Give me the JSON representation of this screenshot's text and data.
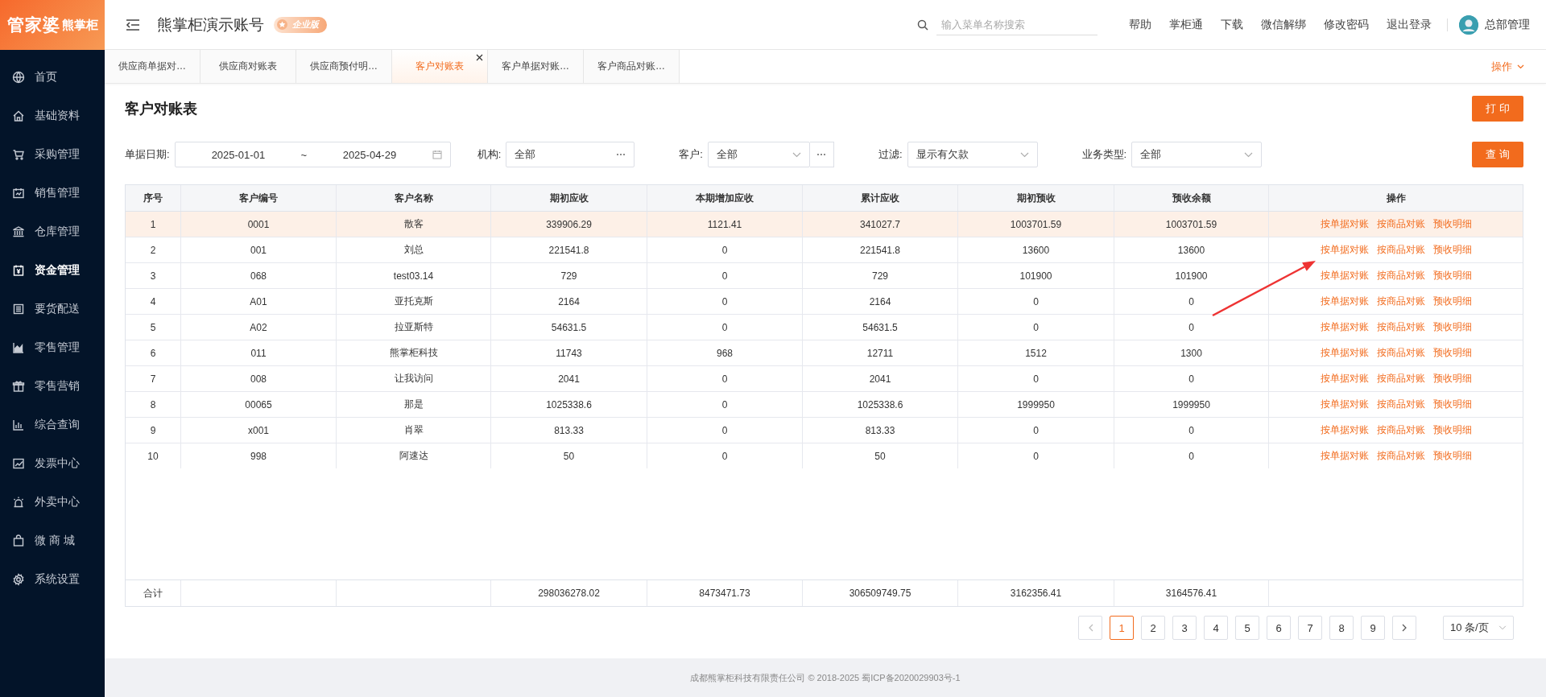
{
  "logo": {
    "main": "管家婆",
    "sub": "熊掌柜"
  },
  "header": {
    "account": "熊掌柜演示账号",
    "badge": "企业版",
    "search": {
      "placeholder": "输入菜单名称搜索"
    },
    "links": [
      "帮助",
      "掌柜通",
      "下载",
      "微信解绑",
      "修改密码",
      "退出登录"
    ],
    "user": "总部管理"
  },
  "sidebar": {
    "items": [
      {
        "label": "首页",
        "selected": false
      },
      {
        "label": "基础资料",
        "selected": false
      },
      {
        "label": "采购管理",
        "selected": false
      },
      {
        "label": "销售管理",
        "selected": false
      },
      {
        "label": "仓库管理",
        "selected": false
      },
      {
        "label": "资金管理",
        "selected": true
      },
      {
        "label": "要货配送",
        "selected": false
      },
      {
        "label": "零售管理",
        "selected": false
      },
      {
        "label": "零售营销",
        "selected": false
      },
      {
        "label": "综合查询",
        "selected": false
      },
      {
        "label": "发票中心",
        "selected": false
      },
      {
        "label": "外卖中心",
        "selected": false
      },
      {
        "label": "微 商 城",
        "selected": false
      },
      {
        "label": "系统设置",
        "selected": false
      }
    ]
  },
  "tabs": {
    "items": [
      {
        "label": "供应商单据对…",
        "selected": false
      },
      {
        "label": "供应商对账表",
        "selected": false
      },
      {
        "label": "供应商预付明…",
        "selected": false
      },
      {
        "label": "客户对账表",
        "selected": true
      },
      {
        "label": "客户单据对账…",
        "selected": false
      },
      {
        "label": "客户商品对账…",
        "selected": false
      }
    ],
    "menu": "操作"
  },
  "page": {
    "title": "客户对账表",
    "print_button": "打 印",
    "query_button": "查 询"
  },
  "filters": [
    {
      "kind": "daterange",
      "label": "单据日期:",
      "start": "2025-01-01",
      "separator": "~",
      "end": "2025-04-29"
    },
    {
      "kind": "picker",
      "label": "机构:",
      "value": "全部"
    },
    {
      "kind": "select_picker",
      "label": "客户:",
      "value": "全部"
    },
    {
      "kind": "select",
      "label": "过滤:",
      "value": "显示有欠款"
    },
    {
      "kind": "select",
      "label": "业务类型:",
      "value": "全部"
    }
  ],
  "table": {
    "columns": [
      "序号",
      "客户编号",
      "客户名称",
      "期初应收",
      "本期增加应收",
      "累计应收",
      "期初预收",
      "预收余额",
      "操作"
    ],
    "rows": [
      {
        "cells": [
          "1",
          "0001",
          "散客",
          "339906.29",
          "1121.41",
          "341027.7",
          "1003701.59",
          "1003701.59"
        ],
        "actions": [
          "按单据对账",
          "按商品对账",
          "预收明细"
        ],
        "selected": true
      },
      {
        "cells": [
          "2",
          "001",
          "刘总",
          "221541.8",
          "0",
          "221541.8",
          "13600",
          "13600"
        ],
        "actions": [
          "按单据对账",
          "按商品对账",
          "预收明细"
        ],
        "selected": false
      },
      {
        "cells": [
          "3",
          "068",
          "test03.14",
          "729",
          "0",
          "729",
          "101900",
          "101900"
        ],
        "actions": [
          "按单据对账",
          "按商品对账",
          "预收明细"
        ],
        "selected": false
      },
      {
        "cells": [
          "4",
          "A01",
          "亚托克斯",
          "2164",
          "0",
          "2164",
          "0",
          "0"
        ],
        "actions": [
          "按单据对账",
          "按商品对账",
          "预收明细"
        ],
        "selected": false
      },
      {
        "cells": [
          "5",
          "A02",
          "拉亚斯特",
          "54631.5",
          "0",
          "54631.5",
          "0",
          "0"
        ],
        "actions": [
          "按单据对账",
          "按商品对账",
          "预收明细"
        ],
        "selected": false
      },
      {
        "cells": [
          "6",
          "011",
          "熊掌柜科技",
          "11743",
          "968",
          "12711",
          "1512",
          "1300"
        ],
        "actions": [
          "按单据对账",
          "按商品对账",
          "预收明细"
        ],
        "selected": false
      },
      {
        "cells": [
          "7",
          "008",
          "让我访问",
          "2041",
          "0",
          "2041",
          "0",
          "0"
        ],
        "actions": [
          "按单据对账",
          "按商品对账",
          "预收明细"
        ],
        "selected": false
      },
      {
        "cells": [
          "8",
          "00065",
          "那是",
          "1025338.6",
          "0",
          "1025338.6",
          "1999950",
          "1999950"
        ],
        "actions": [
          "按单据对账",
          "按商品对账",
          "预收明细"
        ],
        "selected": false
      },
      {
        "cells": [
          "9",
          "x001",
          "肖翠",
          "813.33",
          "0",
          "813.33",
          "0",
          "0"
        ],
        "actions": [
          "按单据对账",
          "按商品对账",
          "预收明细"
        ],
        "selected": false
      },
      {
        "cells": [
          "10",
          "998",
          "阿速达",
          "50",
          "0",
          "50",
          "0",
          "0"
        ],
        "actions": [
          "按单据对账",
          "按商品对账",
          "预收明细"
        ],
        "selected": false
      }
    ],
    "totals": {
      "label": "合计",
      "values": [
        "298036278.02",
        "8473471.73",
        "306509749.75",
        "3162356.41",
        "3164576.41"
      ]
    }
  },
  "pagination": {
    "pages": [
      {
        "label": "1",
        "selected": true
      },
      {
        "label": "2",
        "selected": false
      },
      {
        "label": "3",
        "selected": false
      },
      {
        "label": "4",
        "selected": false
      },
      {
        "label": "5",
        "selected": false
      },
      {
        "label": "6",
        "selected": false
      },
      {
        "label": "7",
        "selected": false
      },
      {
        "label": "8",
        "selected": false
      },
      {
        "label": "9",
        "selected": false
      }
    ],
    "page_size": "10 条/页"
  },
  "footer": "成都熊掌柜科技有限责任公司 © 2018-2025 蜀ICP备2020029903号-1"
}
